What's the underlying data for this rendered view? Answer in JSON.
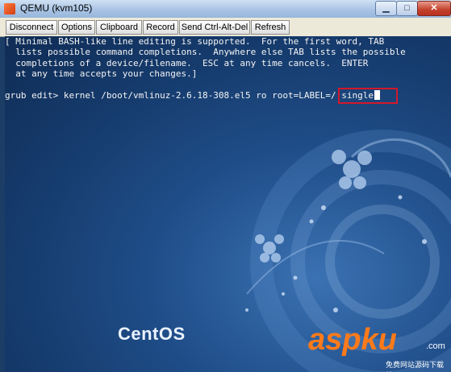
{
  "window": {
    "title": "QEMU (kvm105)"
  },
  "toolbar": {
    "buttons": [
      "Disconnect",
      "Options",
      "Clipboard",
      "Record",
      "Send Ctrl-Alt-Del",
      "Refresh"
    ]
  },
  "console": {
    "help_lines": [
      "[ Minimal BASH-like line editing is supported.  For the first word, TAB",
      "  lists possible command completions.  Anywhere else TAB lists the possible",
      "  completions of a device/filename.  ESC at any time cancels.  ENTER",
      "  at any time accepts your changes.]"
    ],
    "prompt": "grub edit> ",
    "command": "kernel /boot/vmlinuz-2.6.18-308.el5 ro root=LABEL=/ single"
  },
  "desktop": {
    "brand": "CentOS"
  },
  "watermark": {
    "main": "aspku",
    "suffix": ".com",
    "sub": "免费网站源码下载站!"
  }
}
